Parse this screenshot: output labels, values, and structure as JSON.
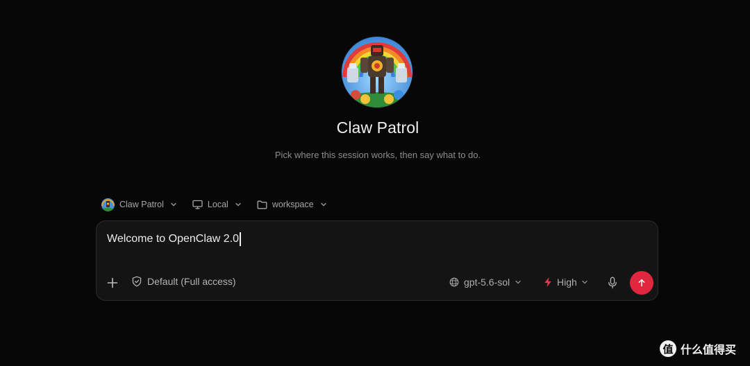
{
  "agent": {
    "name": "Claw Patrol",
    "subtitle": "Pick where this session works, then say what to do."
  },
  "selectors": {
    "agent_label": "Claw Patrol",
    "environment_label": "Local",
    "folder_label": "workspace"
  },
  "composer": {
    "message": "Welcome to OpenClaw 2.0",
    "access_label": "Default (Full access)",
    "model_label": "gpt-5.6-sol",
    "effort_label": "High"
  },
  "watermark": {
    "logo_glyph": "值",
    "text": "什么值得买"
  },
  "colors": {
    "background": "#070707",
    "composer_bg": "#141414",
    "send_button": "#e0273d",
    "effort_icon": "#e8384f"
  },
  "icons": {
    "selector_chevron": "chevron-down-icon",
    "environment": "monitor-icon",
    "folder": "folder-icon",
    "attach": "plus-icon",
    "access": "shield-check-icon",
    "model": "globe-icon",
    "effort": "lightning-icon",
    "voice": "microphone-icon",
    "send": "arrow-up-icon"
  }
}
